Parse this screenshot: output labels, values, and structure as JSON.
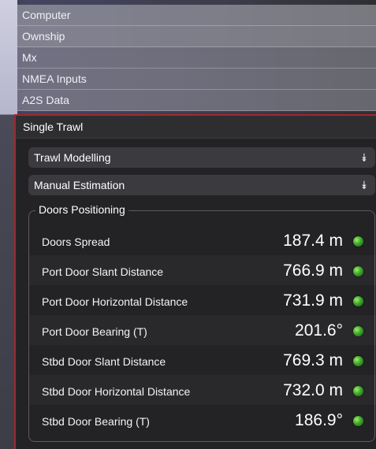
{
  "menu": {
    "items": [
      "Computer",
      "Ownship",
      "Mx",
      "NMEA Inputs",
      "A2S Data"
    ]
  },
  "panel": {
    "title": "Single Trawl",
    "dropdowns": [
      {
        "label": "Trawl Modelling",
        "icon": "double-chevron-down-icon"
      },
      {
        "label": "Manual Estimation",
        "icon": "double-chevron-down-icon"
      }
    ],
    "group": {
      "title": "Doors Positioning",
      "rows": [
        {
          "label": "Doors Spread",
          "value": "187.4 m",
          "status": "ok"
        },
        {
          "label": "Port Door Slant Distance",
          "value": "766.9 m",
          "status": "ok"
        },
        {
          "label": "Port Door Horizontal Distance",
          "value": "731.9 m",
          "status": "ok"
        },
        {
          "label": "Port Door Bearing (T)",
          "value": "201.6°",
          "status": "ok"
        },
        {
          "label": "Stbd Door Slant Distance",
          "value": "769.3 m",
          "status": "ok"
        },
        {
          "label": "Stbd Door Horizontal Distance",
          "value": "732.0 m",
          "status": "ok"
        },
        {
          "label": "Stbd Door Bearing (T)",
          "value": "186.9°",
          "status": "ok"
        }
      ]
    }
  },
  "colors": {
    "accent_border": "#a0282d",
    "status_ok": "#3ea52a"
  }
}
